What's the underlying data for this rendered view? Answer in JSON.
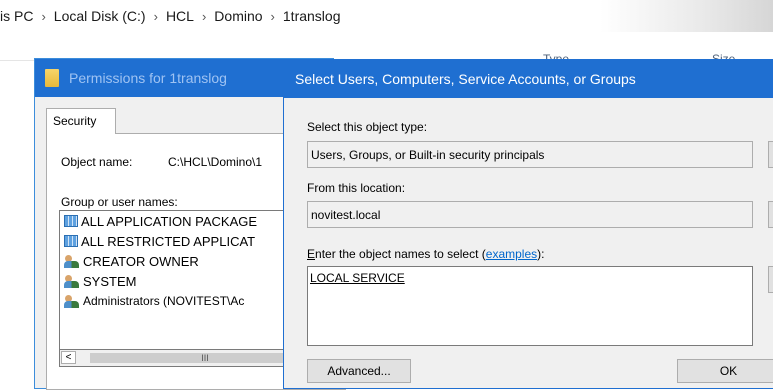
{
  "breadcrumb": {
    "items": [
      "is PC",
      "Local Disk (C:)",
      "HCL",
      "Domino",
      "1translog"
    ],
    "separator": "›"
  },
  "columns": {
    "type": "Type",
    "size": "Size"
  },
  "permissions_dialog": {
    "title": "Permissions for 1translog",
    "tab": "Security",
    "object_name_label": "Object name:",
    "object_name_value": "C:\\HCL\\Domino\\1",
    "group_label": "Group or user names:",
    "groups": [
      {
        "label": "ALL APPLICATION PACKAGE",
        "icon": "package-icon"
      },
      {
        "label": "ALL RESTRICTED APPLICAT",
        "icon": "package-icon"
      },
      {
        "label": "CREATOR OWNER",
        "icon": "users-icon"
      },
      {
        "label": "SYSTEM",
        "icon": "users-icon"
      },
      {
        "label": "Administrators (NOVITEST\\Ac",
        "icon": "users-icon"
      }
    ],
    "scroll_left": "<",
    "scroll_thumb": "III"
  },
  "select_dialog": {
    "title": "Select Users, Computers, Service Accounts, or Groups",
    "object_type_label": "Select this object type:",
    "object_type_value": "Users, Groups, or Built-in security principals",
    "location_label": "From this location:",
    "location_value": "novitest.local",
    "enter_label_prefix": "nter the object names to select (",
    "enter_label_underlined": "E",
    "examples_link": "examples",
    "enter_label_suffix": "):",
    "names_value": "LOCAL SERVICE",
    "advanced_button": "Advanced...",
    "ok_button": "OK"
  },
  "colors": {
    "title_active": "#1f6fd1",
    "title_inactive_text": "#9fc3f3",
    "link": "#0066cc"
  }
}
